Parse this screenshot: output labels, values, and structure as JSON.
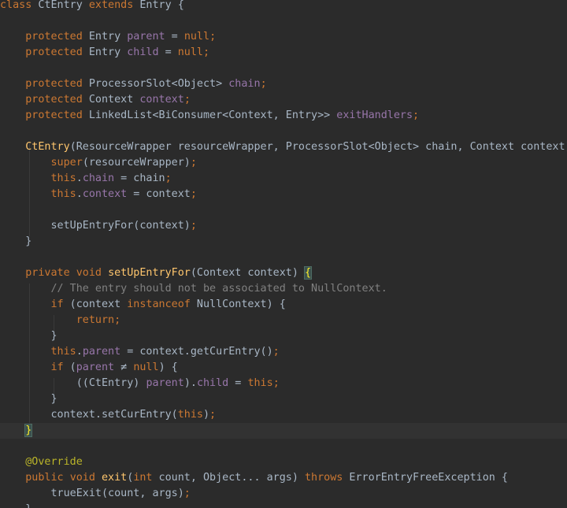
{
  "colors": {
    "background": "#2b2b2b",
    "current_line": "#323232",
    "keyword": "#cc7832",
    "field": "#9876aa",
    "method_declaration": "#ffc66d",
    "comment": "#808080",
    "annotation": "#bbb529",
    "plain": "#a9b7c6",
    "brace_match": "#ffef28"
  },
  "editor": {
    "lines": [
      [
        {
          "t": "class",
          "c": "kw"
        },
        {
          "t": " CtEntry ",
          "c": "plain"
        },
        {
          "t": "extends",
          "c": "kw"
        },
        {
          "t": " Entry {",
          "c": "plain"
        }
      ],
      [],
      [
        {
          "t": "    protected",
          "c": "kw"
        },
        {
          "t": " Entry ",
          "c": "plain"
        },
        {
          "t": "parent",
          "c": "fld"
        },
        {
          "t": " = ",
          "c": "plain"
        },
        {
          "t": "null",
          "c": "kw"
        },
        {
          "t": ";",
          "c": "kw"
        }
      ],
      [
        {
          "t": "    protected",
          "c": "kw"
        },
        {
          "t": " Entry ",
          "c": "plain"
        },
        {
          "t": "child",
          "c": "fld"
        },
        {
          "t": " = ",
          "c": "plain"
        },
        {
          "t": "null",
          "c": "kw"
        },
        {
          "t": ";",
          "c": "kw"
        }
      ],
      [],
      [
        {
          "t": "    protected",
          "c": "kw"
        },
        {
          "t": " ProcessorSlot<Object> ",
          "c": "plain"
        },
        {
          "t": "chain",
          "c": "fld"
        },
        {
          "t": ";",
          "c": "kw"
        }
      ],
      [
        {
          "t": "    protected",
          "c": "kw"
        },
        {
          "t": " Context ",
          "c": "plain"
        },
        {
          "t": "context",
          "c": "fld"
        },
        {
          "t": ";",
          "c": "kw"
        }
      ],
      [
        {
          "t": "    protected",
          "c": "kw"
        },
        {
          "t": " LinkedList<BiConsumer<Context, Entry>> ",
          "c": "plain"
        },
        {
          "t": "exitHandlers",
          "c": "fld"
        },
        {
          "t": ";",
          "c": "kw"
        }
      ],
      [],
      [
        {
          "t": "    ",
          "c": "plain"
        },
        {
          "t": "CtEntry",
          "c": "fn"
        },
        {
          "t": "(ResourceWrapper resourceWrapper, ProcessorSlot<Object> chain, Context context) {",
          "c": "plain"
        }
      ],
      [
        {
          "t": "        ",
          "c": "plain"
        },
        {
          "t": "super",
          "c": "kw"
        },
        {
          "t": "(resourceWrapper)",
          "c": "plain"
        },
        {
          "t": ";",
          "c": "kw"
        }
      ],
      [
        {
          "t": "        ",
          "c": "plain"
        },
        {
          "t": "this",
          "c": "kw"
        },
        {
          "t": ".",
          "c": "plain"
        },
        {
          "t": "chain",
          "c": "fld"
        },
        {
          "t": " = chain",
          "c": "plain"
        },
        {
          "t": ";",
          "c": "kw"
        }
      ],
      [
        {
          "t": "        ",
          "c": "plain"
        },
        {
          "t": "this",
          "c": "kw"
        },
        {
          "t": ".",
          "c": "plain"
        },
        {
          "t": "context",
          "c": "fld"
        },
        {
          "t": " = context",
          "c": "plain"
        },
        {
          "t": ";",
          "c": "kw"
        }
      ],
      [],
      [
        {
          "t": "        setUpEntryFor(context)",
          "c": "plain"
        },
        {
          "t": ";",
          "c": "kw"
        }
      ],
      [
        {
          "t": "    }",
          "c": "plain"
        }
      ],
      [],
      [
        {
          "t": "    private",
          "c": "kw"
        },
        {
          "t": " ",
          "c": "plain"
        },
        {
          "t": "void",
          "c": "kw"
        },
        {
          "t": " ",
          "c": "plain"
        },
        {
          "t": "setUpEntryFor",
          "c": "fn"
        },
        {
          "t": "(Context context) ",
          "c": "plain"
        },
        {
          "t": "{",
          "c": "brace-match"
        }
      ],
      [
        {
          "t": "        // The entry should not be associated to NullContext.",
          "c": "cmt"
        }
      ],
      [
        {
          "t": "        ",
          "c": "plain"
        },
        {
          "t": "if",
          "c": "kw"
        },
        {
          "t": " (context ",
          "c": "plain"
        },
        {
          "t": "instanceof",
          "c": "kw"
        },
        {
          "t": " NullContext) {",
          "c": "plain"
        }
      ],
      [
        {
          "t": "            ",
          "c": "plain"
        },
        {
          "t": "return",
          "c": "kw"
        },
        {
          "t": ";",
          "c": "kw"
        }
      ],
      [
        {
          "t": "        }",
          "c": "plain"
        }
      ],
      [
        {
          "t": "        ",
          "c": "plain"
        },
        {
          "t": "this",
          "c": "kw"
        },
        {
          "t": ".",
          "c": "plain"
        },
        {
          "t": "parent",
          "c": "fld"
        },
        {
          "t": " = context.getCurEntry()",
          "c": "plain"
        },
        {
          "t": ";",
          "c": "kw"
        }
      ],
      [
        {
          "t": "        ",
          "c": "plain"
        },
        {
          "t": "if",
          "c": "kw"
        },
        {
          "t": " (",
          "c": "plain"
        },
        {
          "t": "parent",
          "c": "fld"
        },
        {
          "t": " ≠ ",
          "c": "plain"
        },
        {
          "t": "null",
          "c": "kw"
        },
        {
          "t": ") {",
          "c": "plain"
        }
      ],
      [
        {
          "t": "            ((CtEntry) ",
          "c": "plain"
        },
        {
          "t": "parent",
          "c": "fld"
        },
        {
          "t": ").",
          "c": "plain"
        },
        {
          "t": "child",
          "c": "fld"
        },
        {
          "t": " = ",
          "c": "plain"
        },
        {
          "t": "this",
          "c": "kw"
        },
        {
          "t": ";",
          "c": "kw"
        }
      ],
      [
        {
          "t": "        }",
          "c": "plain"
        }
      ],
      [
        {
          "t": "        context.setCurEntry(",
          "c": "plain"
        },
        {
          "t": "this",
          "c": "kw"
        },
        {
          "t": ")",
          "c": "plain"
        },
        {
          "t": ";",
          "c": "kw"
        }
      ],
      [
        {
          "t": "    ",
          "c": "plain"
        },
        {
          "t": "}",
          "c": "brace-match"
        }
      ],
      [],
      [
        {
          "t": "    @Override",
          "c": "ann"
        }
      ],
      [
        {
          "t": "    public",
          "c": "kw"
        },
        {
          "t": " ",
          "c": "plain"
        },
        {
          "t": "void",
          "c": "kw"
        },
        {
          "t": " ",
          "c": "plain"
        },
        {
          "t": "exit",
          "c": "fn"
        },
        {
          "t": "(",
          "c": "plain"
        },
        {
          "t": "int",
          "c": "kw"
        },
        {
          "t": " count, Object... args) ",
          "c": "plain"
        },
        {
          "t": "throws",
          "c": "kw"
        },
        {
          "t": " ErrorEntryFreeException {",
          "c": "plain"
        }
      ],
      [
        {
          "t": "        trueExit(count, args)",
          "c": "plain"
        },
        {
          "t": ";",
          "c": "kw"
        }
      ],
      [
        {
          "t": "    }",
          "c": "plain"
        }
      ]
    ],
    "current_line_index": 27
  }
}
